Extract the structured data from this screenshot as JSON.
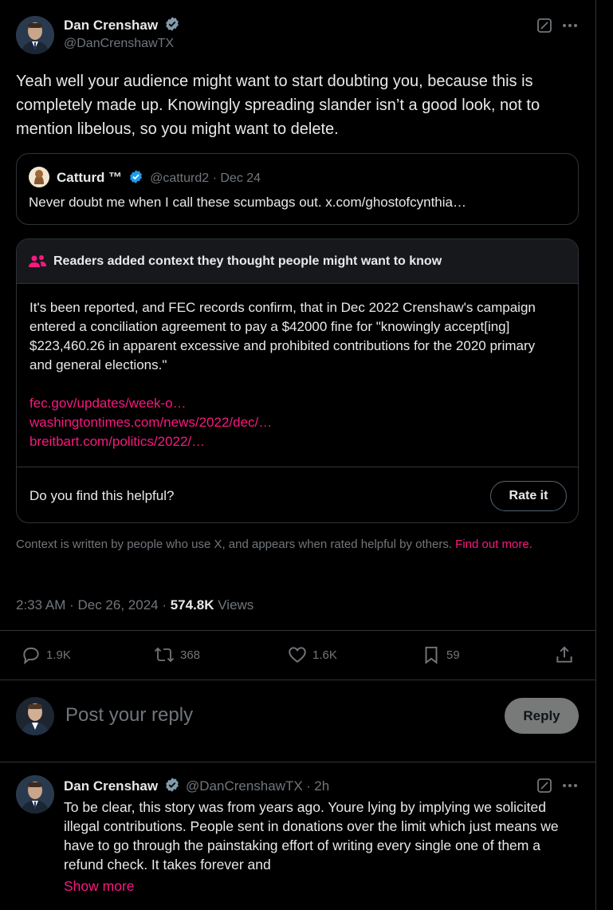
{
  "tweet": {
    "author_name": "Dan Crenshaw",
    "author_handle": "@DanCrenshawTX",
    "text": "Yeah well your audience might want to start doubting you, because this is completely made up. Knowingly spreading slander isn’t a good look, not to mention libelous, so you might want to delete.",
    "quote": {
      "author_name": "Catturd ™",
      "author_handle": "@catturd2",
      "separator": "·",
      "date": "Dec 24",
      "text": "Never doubt me when I call these scumbags out. x.com/ghostofcynthia…"
    },
    "note": {
      "header": "Readers added context they thought people might want to know",
      "body": "It's been reported, and FEC records confirm, that in Dec 2022 Crenshaw's campaign entered a conciliation agreement to pay a $42000 fine for \"knowingly accept[ing] $223,460.26 in apparent excessive and prohibited contributions for the 2020 primary and general elections.\"",
      "links": [
        "fec.gov/updates/week-o…",
        "washingtontimes.com/news/2022/dec/…",
        "breitbart.com/politics/2022/…"
      ],
      "helpful_question": "Do you find this helpful?",
      "rate_label": "Rate it"
    },
    "context_disclaimer": "Context is written by people who use X, and appears when rated helpful by others.",
    "find_out_more_1": "Find out",
    "find_out_more_2": "more",
    "find_out_more_period": ".",
    "timestamp": "2:33 AM · Dec 26, 2024 · ",
    "views_count": "574.8K",
    "views_label": " Views",
    "stats": {
      "replies": "1.9K",
      "reposts": "368",
      "likes": "1.6K",
      "bookmarks": "59"
    }
  },
  "reply_box": {
    "placeholder": "Post your reply",
    "button_label": "Reply"
  },
  "reply": {
    "author_name": "Dan Crenshaw",
    "author_handle": "@DanCrenshawTX",
    "separator": "·",
    "age": "2h",
    "text": "To be clear, this story was from years ago. Youre lying by implying we solicited illegal contributions. People sent in donations over the limit which just means we have to go through the painstaking effort of writing every single one of them a refund check. It takes forever and",
    "show_more": "Show more"
  },
  "colors": {
    "background": "#000000",
    "text": "#e7e9ea",
    "muted": "#71767b",
    "link": "#f91880",
    "verified": "#1d9bf0",
    "border": "#2f3336"
  },
  "icons": [
    "verified-badge-icon",
    "grok-icon",
    "more-icon",
    "people-icon",
    "reply-icon",
    "repost-icon",
    "like-icon",
    "bookmark-icon",
    "share-icon"
  ]
}
